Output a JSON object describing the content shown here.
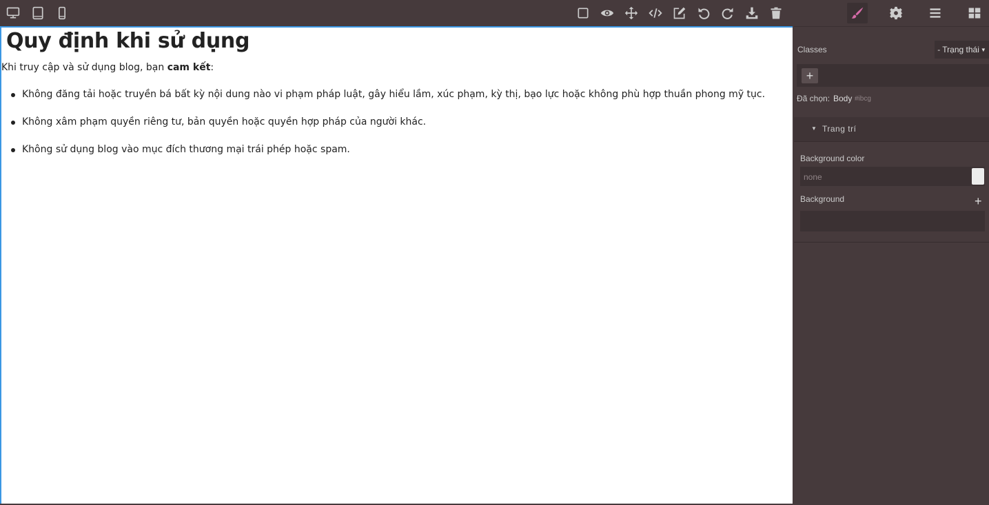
{
  "icons": {
    "devices": [
      "desktop-icon",
      "tablet-icon",
      "mobile-icon"
    ],
    "actions": [
      "square-outline-icon",
      "eye-icon",
      "move-arrows-icon",
      "code-icon",
      "edit-icon",
      "undo-icon",
      "redo-icon",
      "download-icon",
      "trash-icon"
    ],
    "panels": [
      "paint-brush-icon",
      "gear-icon",
      "menu-lines-icon",
      "blocks-grid-icon"
    ]
  },
  "colors": {
    "accent": "#3b97e3",
    "brush": "#d66ba8",
    "panel_bg": "#463a3c"
  },
  "page": {
    "title": "Quy định khi sử dụng",
    "intro_before": "Khi truy cập và sử dụng blog, bạn ",
    "intro_bold": "cam kết",
    "intro_after": ":",
    "items": [
      "Không đăng tải hoặc truyền bá bất kỳ nội dung nào vi phạm pháp luật, gây hiểu lầm, xúc phạm, kỳ thị, bạo lực hoặc không phù hợp thuần phong mỹ tục.",
      "Không xâm phạm quyền riêng tư, bản quyền hoặc quyền hợp pháp của người khác.",
      "Không sử dụng blog vào mục đích thương mại trái phép hoặc spam."
    ]
  },
  "panel": {
    "classes_label": "Classes",
    "state_select": "- Trạng thái",
    "add_label": "+",
    "selected_label": "Đã chọn:",
    "selected_value": "Body",
    "selected_id": "#ibcg",
    "sector_title": "Trang trí",
    "bg_color_label": "Background color",
    "bg_color_placeholder": "none",
    "background_label": "Background",
    "background_add": "+"
  }
}
